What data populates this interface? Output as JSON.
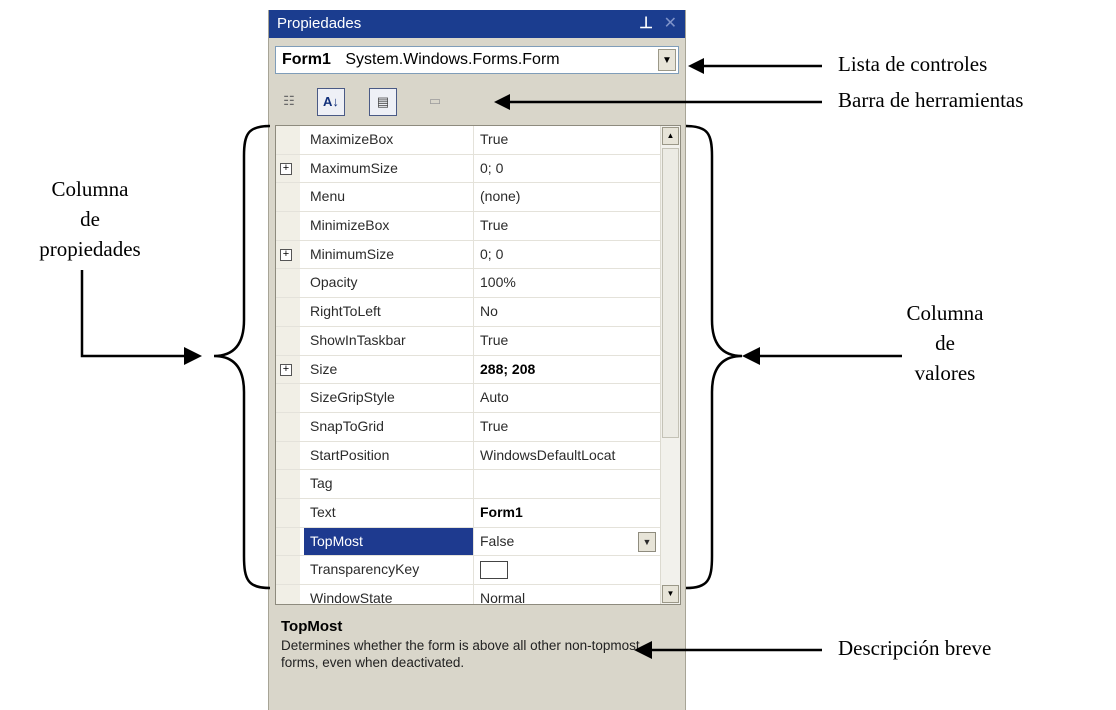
{
  "window": {
    "title": "Propiedades",
    "pin_icon": "pin-icon",
    "close_icon": "close-icon"
  },
  "object_selector": {
    "object_name": "Form1",
    "object_type": "System.Windows.Forms.Form",
    "dropdown_icon": "chevron-down-icon"
  },
  "toolbar": {
    "buttons": [
      {
        "icon": "categorized-icon",
        "glyph": "☷",
        "pressed": false
      },
      {
        "icon": "alphabetical-icon",
        "glyph": "A↓",
        "pressed": true
      },
      {
        "icon": "properties-icon",
        "glyph": "▤",
        "pressed": true
      },
      {
        "icon": "events-icon",
        "glyph": "▭",
        "pressed": false
      }
    ]
  },
  "properties": [
    {
      "name": "MaximizeBox",
      "value": "True",
      "expandable": false
    },
    {
      "name": "MaximumSize",
      "value": "0; 0",
      "expandable": true
    },
    {
      "name": "Menu",
      "value": "(none)",
      "expandable": false
    },
    {
      "name": "MinimizeBox",
      "value": "True",
      "expandable": false
    },
    {
      "name": "MinimumSize",
      "value": "0; 0",
      "expandable": true
    },
    {
      "name": "Opacity",
      "value": "100%",
      "expandable": false
    },
    {
      "name": "RightToLeft",
      "value": "No",
      "expandable": false
    },
    {
      "name": "ShowInTaskbar",
      "value": "True",
      "expandable": false
    },
    {
      "name": "Size",
      "value": "288; 208",
      "expandable": true,
      "bold": true
    },
    {
      "name": "SizeGripStyle",
      "value": "Auto",
      "expandable": false
    },
    {
      "name": "SnapToGrid",
      "value": "True",
      "expandable": false
    },
    {
      "name": "StartPosition",
      "value": "WindowsDefaultLocat",
      "expandable": false
    },
    {
      "name": "Tag",
      "value": "",
      "expandable": false
    },
    {
      "name": "Text",
      "value": "Form1",
      "expandable": false,
      "bold": true
    },
    {
      "name": "TopMost",
      "value": "False",
      "expandable": false,
      "selected": true
    },
    {
      "name": "TransparencyKey",
      "value": "",
      "expandable": false,
      "swatch": true
    },
    {
      "name": "WindowState",
      "value": "Normal",
      "expandable": false
    }
  ],
  "description": {
    "title": "TopMost",
    "text": "Determines whether the form is above all other non-topmost forms, even when deactivated."
  },
  "annotations": {
    "lista_controles": "Lista de controles",
    "barra_herramientas": "Barra de herramientas",
    "columna_propiedades": [
      "Columna",
      "de",
      "propiedades"
    ],
    "columna_valores": [
      "Columna",
      "de",
      "valores"
    ],
    "descripcion_breve": "Descripción breve"
  },
  "colors": {
    "titlebar": "#1b3d8f",
    "selected_row": "#1e3a8f",
    "panel_bg": "#d9d6ca"
  }
}
